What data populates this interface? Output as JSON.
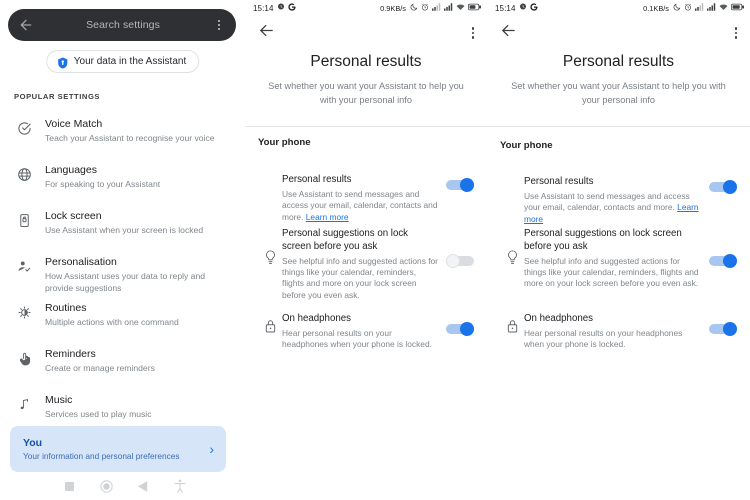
{
  "settings_panel": {
    "search": {
      "placeholder": "Search settings",
      "back_icon": "back-arrow-icon",
      "overflow_icon": "kebab-menu-icon"
    },
    "assistant_chip": {
      "label": "Your data in the Assistant",
      "icon": "shield-icon"
    },
    "section_header": "POPULAR SETTINGS",
    "items": [
      {
        "icon": "voice-match-icon",
        "title": "Voice Match",
        "subtitle": "Teach your Assistant to recognise your voice"
      },
      {
        "icon": "globe-icon",
        "title": "Languages",
        "subtitle": "For speaking to your Assistant"
      },
      {
        "icon": "lock-screen-icon",
        "title": "Lock screen",
        "subtitle": "Use Assistant when your screen is locked"
      },
      {
        "icon": "person-check-icon",
        "title": "Personalisation",
        "subtitle": "How Assistant uses your data to reply and provide suggestions"
      },
      {
        "icon": "routines-icon",
        "title": "Routines",
        "subtitle": "Multiple actions with one command"
      },
      {
        "icon": "hand-tap-icon",
        "title": "Reminders",
        "subtitle": "Create or manage reminders"
      },
      {
        "icon": "music-note-icon",
        "title": "Music",
        "subtitle": "Services used to play music"
      }
    ],
    "you_card": {
      "title": "You",
      "subtitle": "Your information and personal preferences",
      "chevron": "›",
      "background": "#d7e5f8",
      "title_color": "#174ea6"
    },
    "navbar": [
      {
        "icon": "recents-square-icon"
      },
      {
        "icon": "home-circle-icon"
      },
      {
        "icon": "back-triangle-icon"
      },
      {
        "icon": "accessibility-icon"
      }
    ]
  },
  "middle_panel": {
    "statusbar": {
      "clock": "15:14",
      "alarm_icon": "alarm-icon",
      "google_icon": "google-g-icon",
      "network_speed": "0.9KB/s",
      "icons": [
        "dnd-moon-icon",
        "alarm-clock-icon",
        "signal-1-icon",
        "signal-2-icon",
        "wifi-icon",
        "battery-icon"
      ]
    },
    "topbar": {
      "back_icon": "back-arrow-icon",
      "overflow_icon": "kebab-menu-icon"
    },
    "title": "Personal results",
    "subtitle": "Set whether you want your Assistant to help you with your personal info",
    "section_label": "Your phone",
    "rows": [
      {
        "icon": null,
        "title": "Personal results",
        "description": "Use Assistant to send messages and access your email, calendar, contacts and more.",
        "link": "Learn more",
        "toggle": "on"
      },
      {
        "icon": "lightbulb-icon",
        "title": "Personal suggestions on lock screen before you ask",
        "description": "See helpful info and suggested actions for things like your calendar, reminders, flights and more on your lock screen before you even ask.",
        "link": null,
        "toggle": "off"
      },
      {
        "icon": "lock-icon",
        "title": "On headphones",
        "description": "Hear personal results on your headphones when your phone is locked.",
        "link": null,
        "toggle": "on"
      }
    ]
  },
  "right_panel": {
    "statusbar": {
      "clock": "15:14",
      "alarm_icon": "alarm-icon",
      "google_icon": "google-g-icon",
      "network_speed": "0.1KB/s",
      "icons": [
        "dnd-moon-icon",
        "alarm-clock-icon",
        "signal-1-icon",
        "signal-2-icon",
        "wifi-icon",
        "battery-icon"
      ]
    },
    "topbar": {
      "back_icon": "back-arrow-icon",
      "overflow_icon": "kebab-menu-icon"
    },
    "title": "Personal results",
    "subtitle": "Set whether you want your Assistant to help you with your personal info",
    "section_label": "Your phone",
    "rows": [
      {
        "icon": null,
        "title": "Personal results",
        "description": "Use Assistant to send messages and access your email, calendar, contacts and more.",
        "link": "Learn more",
        "toggle": "on"
      },
      {
        "icon": "lightbulb-icon",
        "title": "Personal suggestions on lock screen before you ask",
        "description": "See helpful info and suggested actions for things like your calendar, reminders, flights and more on your lock screen before you even ask.",
        "link": null,
        "toggle": "on"
      },
      {
        "icon": "lock-icon",
        "title": "On headphones",
        "description": "Hear personal results on your headphones when your phone is locked.",
        "link": null,
        "toggle": "on"
      }
    ]
  },
  "colors": {
    "accent_blue": "#1a73e8",
    "toggle_on_track": "#a8c7f0",
    "toggle_off_track": "#dadce0",
    "search_bg": "#2f3033",
    "card_bg": "#d7e5f8",
    "text_primary": "#202124",
    "text_secondary": "#80868b"
  }
}
